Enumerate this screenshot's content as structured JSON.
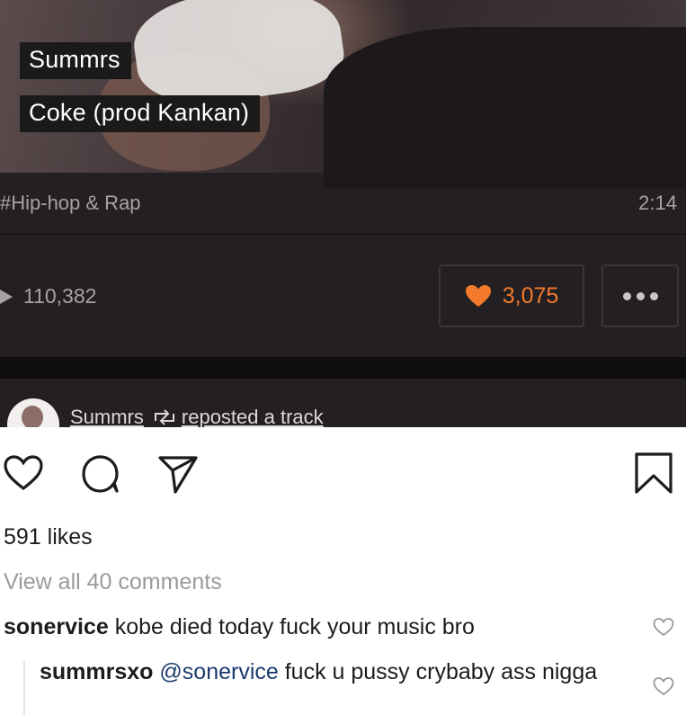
{
  "track": {
    "artist": "Summrs",
    "title": "Coke (prod Kankan)",
    "genre": "#Hip-hop & Rap",
    "duration": "2:14",
    "plays": "110,382",
    "likes": "3,075"
  },
  "repost": {
    "user": "Summrs",
    "action": "reposted a track"
  },
  "post": {
    "likes_text": "591 likes",
    "view_comments": "View all 40 comments"
  },
  "comments": [
    {
      "user": "sonervice",
      "text": "kobe died today fuck your music bro"
    },
    {
      "user": "summrsxo",
      "mention": "@sonervice",
      "text": "fuck u pussy crybaby ass nigga"
    }
  ],
  "colors": {
    "soundcloud_bg": "#231f22",
    "soundcloud_orange": "#f47a2c",
    "ig_text": "#1c1c1c",
    "ig_muted": "#9a9a9a"
  },
  "icons": [
    "play-icon",
    "heart-icon",
    "more-icon",
    "repost-icon",
    "like-icon",
    "comment-icon",
    "share-icon",
    "save-icon"
  ]
}
